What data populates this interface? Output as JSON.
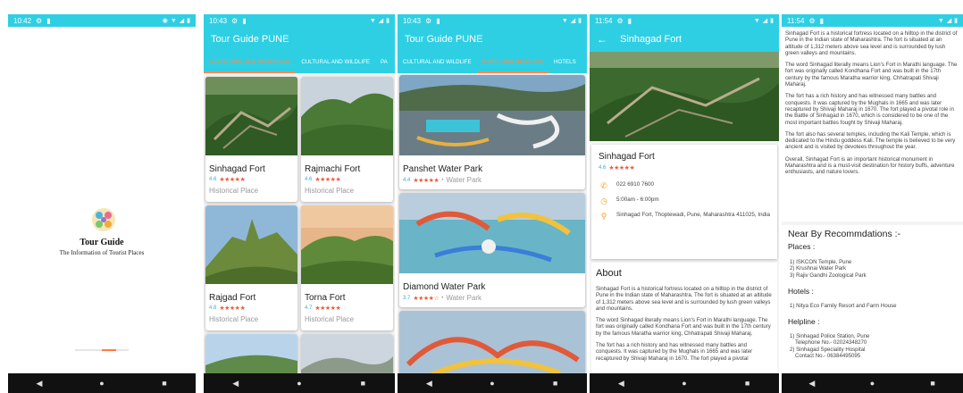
{
  "colors": {
    "primary": "#2ecfe3",
    "accent": "#ff8a50",
    "star": "#ef5a3c",
    "rating_num": "#3fa9e0",
    "icon": "#f5a020"
  },
  "screen1": {
    "status_time": "10:42",
    "brand_title": "Tour Guide",
    "brand_subtitle": "The Information of Tourist Places"
  },
  "screen2": {
    "status_time": "10:43",
    "title": "Tour Guide PUNE",
    "tabs": [
      "ADVENTURE AND HISTORICAL",
      "CULTURAL AND WILDLIFE",
      "PA"
    ],
    "cards": [
      {
        "name": "Sinhagad Fort",
        "rating": "4.6",
        "stars": 4.5,
        "category": "Historical Place"
      },
      {
        "name": "Rajmachi Fort",
        "rating": "4.6",
        "stars": 4.5,
        "category": "Historical Place"
      },
      {
        "name": "Rajgad Fort",
        "rating": "4.8",
        "stars": 5,
        "category": "Historical Place"
      },
      {
        "name": "Torna Fort",
        "rating": "4.7",
        "stars": 4.5,
        "category": "Historical Place"
      }
    ]
  },
  "screen3": {
    "status_time": "10:43",
    "title": "Tour Guide PUNE",
    "tabs": [
      "CULTURAL AND WILDLIFE",
      "PARKS AND MUSEUMS",
      "HOTELS"
    ],
    "cards": [
      {
        "name": "Panshet Water Park",
        "rating": "4.4",
        "stars": 4.5,
        "category": "Water Park"
      },
      {
        "name": "Diamond Water Park",
        "rating": "3.7",
        "stars": 3.5,
        "category": "Water Park"
      }
    ]
  },
  "screen4": {
    "status_time": "11:54",
    "title": "Sinhagad Fort",
    "name": "Sinhagad Fort",
    "rating": "4.6",
    "stars": 4.5,
    "phone": "022 6910 7600",
    "hours": "5:00am - 6:00pm",
    "address": "Sinhagad Fort, Thoptewadi, Pune, Maharashtra 411025, India",
    "about_heading": "About",
    "about": [
      "Sinhagad Fort is a historical fortress located on a hilltop in the district of Pune in the Indian state of Maharashtra. The fort is situated at an altitude of 1,312 meters above sea level and is surrounded by lush green valleys and mountains.",
      "The word Sinhagad literally means Lion's Fort in Marathi language. The fort was originally called Kondhana Fort and was built in the 17th century by the famous Maratha warrior king, Chhatrapati Shivaji Maharaj.",
      "The fort has a rich history and has witnessed many battles and conquests. It was captured by the Mughals in 1665 and was later recaptured by Shivaji Maharaj in 1670. The fort played a pivotal"
    ]
  },
  "screen5": {
    "status_time": "11:54",
    "about": [
      "Sinhagad Fort is a historical fortress located on a hilltop in the district of Pune in the Indian state of Maharashtra. The fort is situated at an altitude of 1,312 meters above sea level and is surrounded by lush green valleys and mountains.",
      "The word Sinhagad literally means Lion's Fort in Marathi language. The fort was originally called Kondhana Fort and was built in the 17th century by the famous Maratha warrior king, Chhatrapati Shivaji Maharaj.",
      "The fort has a rich history and has witnessed many battles and conquests. It was captured by the Mughals in 1665 and was later recaptured by Shivaji Maharaj in 1670. The fort played a pivotal role in the Battle of Sinhagad in 1670, which is considered to be one of the most important battles fought by Shivaji Maharaj.",
      "The fort also has several temples, including the Kali Temple, which is dedicated to the Hindu goddess Kali. The temple is believed to be very ancient and is visited by devotees throughout the year.",
      "Overall, Sinhagad Fort is an important historical monument in Maharashtra and is a must-visit destination for history buffs, adventure enthusiasts, and nature lovers."
    ],
    "nearby_heading": "Near By Recommdations :-",
    "places_heading": "Places :",
    "places": [
      "1) ISKCON Temple, Pune",
      "2) Krushnai Water Park",
      "3) Rajiv Gandhi Zoological Park"
    ],
    "hotels_heading": "Hotels :",
    "hotels": [
      "1) Nitya Eco Family Resort and Farm House"
    ],
    "helpline_heading": "Helpline :",
    "helpline": [
      "1) Sinhagad Police Station, Pune",
      "Telephone No.- 02024348270",
      "2) Sinhagad Speciality Hospital",
      "Contact No.- 06384495095"
    ]
  }
}
